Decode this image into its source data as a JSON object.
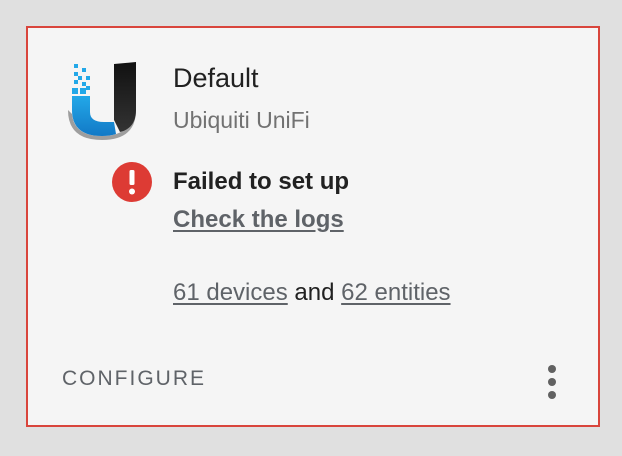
{
  "integration": {
    "title": "Default",
    "subtitle": "Ubiquiti UniFi"
  },
  "status": {
    "message": "Failed to set up",
    "logs_link": "Check the logs",
    "icon": "error-exclamation-icon",
    "color": "#dd3b34"
  },
  "counts": {
    "devices": "61 devices",
    "connector": "and",
    "entities": "62 entities"
  },
  "actions": {
    "configure": "CONFIGURE",
    "menu_icon": "more-vertical-icon"
  },
  "colors": {
    "card_border": "#d9453c",
    "link": "#5f6368"
  }
}
